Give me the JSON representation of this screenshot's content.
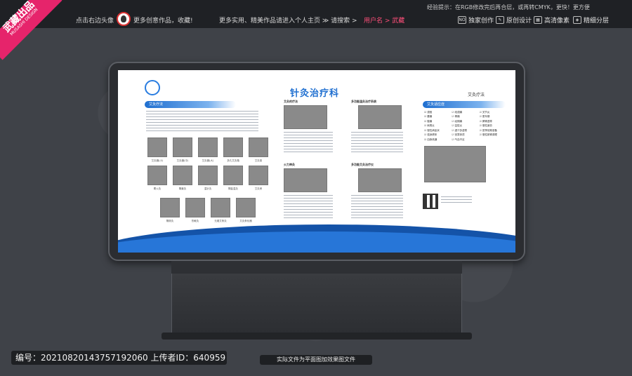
{
  "topbar": {
    "ribbon": {
      "brand": "武藏出品",
      "sub": "MUSASHI DESIGN"
    },
    "click_avatar": "点击右边头像",
    "more_works": "更多创意作品，收藏!",
    "more_practical": "更多实用、精美作品请进入个人主页 ≫ 请搜索 >",
    "username": "用户名 > 武藏",
    "tip": "经验提示：在RGB修改完后再合层，或再转CMYK，更快！更方便",
    "badges": [
      {
        "icon": "NO",
        "label": "独家创作"
      },
      {
        "icon": "✎",
        "label": "原创设计"
      },
      {
        "icon": "▦",
        "label": "高清像素"
      },
      {
        "icon": "◈",
        "label": "精细分层"
      }
    ]
  },
  "panel": {
    "title": "针灸治疗科",
    "subtitle": "艾灸疗法",
    "left_section": "艾灸疗法",
    "right_section": "艾灸适应症",
    "left_captions": [
      "艾灸器(小)",
      "艾灸器(中)",
      "艾灸器(大)",
      "多孔艾灸箱",
      "艾灸架",
      "覆火灸",
      "隔姜灸",
      "温针灸",
      "隔盐温灸",
      "艾灸房",
      "隔蒜灸",
      "热敏灸",
      "无烟艾条灸",
      "艾灸条化器"
    ],
    "mid_sections": [
      "艾灸的疗法",
      "多功能温灸治疗系统",
      "火力神灸",
      "多功能艾灸治疗仪"
    ],
    "indications": [
      "颈椎",
      "线颈痛",
      "关节炎",
      "腰痛",
      "胃痛",
      "更年期",
      "腹痛",
      "经期痛",
      "脾胃虚寒",
      "肩周炎",
      "盆腔炎",
      "慢性疲劳",
      "慢性病症状",
      "虚汗多虚寒",
      "夏季前期准备",
      "强身健体",
      "宫寒体质",
      "慢性肠胃调理",
      "血脉疏通",
      "气血不足"
    ]
  },
  "bottom": {
    "id_text": "编号：20210820143757192060  上传者ID：640959",
    "note": "实际文件为平面图加效果图文件"
  }
}
